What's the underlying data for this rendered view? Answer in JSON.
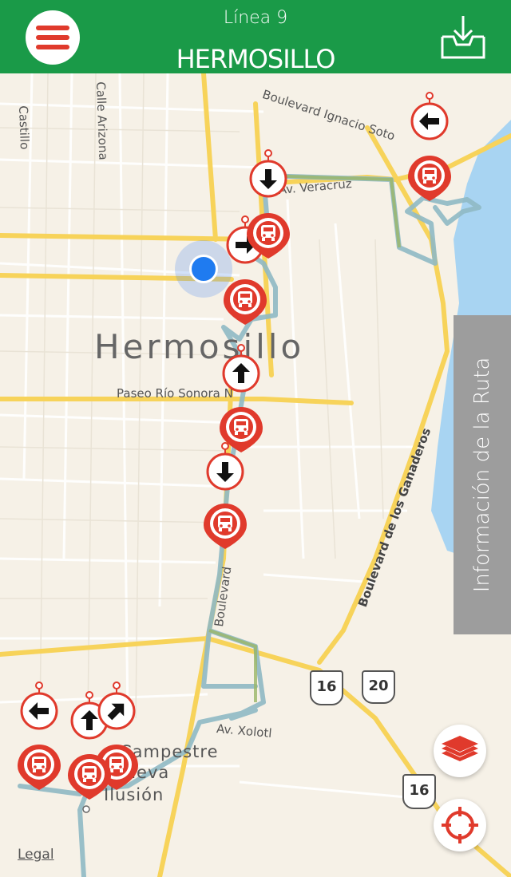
{
  "header": {
    "line_label": "Línea 9",
    "city_title": "HERMOSILLO",
    "menu_icon": "hamburger-menu-icon",
    "download_icon": "download-tray-icon"
  },
  "map": {
    "city_label": "Hermosillo",
    "street_labels": {
      "castillo": "Castillo",
      "calle_arizona": "Calle Arizona",
      "blvd_ignacio_soto": "Boulevard Ignacio Soto",
      "av_veracruz": "Av. Veracruz",
      "paseo_rio_sonora": "Paseo Río Sonora N",
      "blvd_ganaderos": "Boulevard de los Ganaderos",
      "boulevard_lower": "Boulevard",
      "av_xolotl": "Av. Xolotl",
      "campestre": "Campestre",
      "nueva": "Nueva",
      "ilusion": "Ilusión"
    },
    "highway_shields": [
      "16",
      "20",
      "16"
    ],
    "colors": {
      "route": "#8fb9c4",
      "route_highlight": "#9ab767",
      "water": "#a8d4f2",
      "marker": "#e03a2c",
      "user_location": "#1f7bf0"
    }
  },
  "route_info_tab": "Información de la Ruta",
  "buttons": {
    "layers_icon": "layers-icon",
    "locate_icon": "crosshair-locate-icon"
  },
  "legal": "Legal"
}
